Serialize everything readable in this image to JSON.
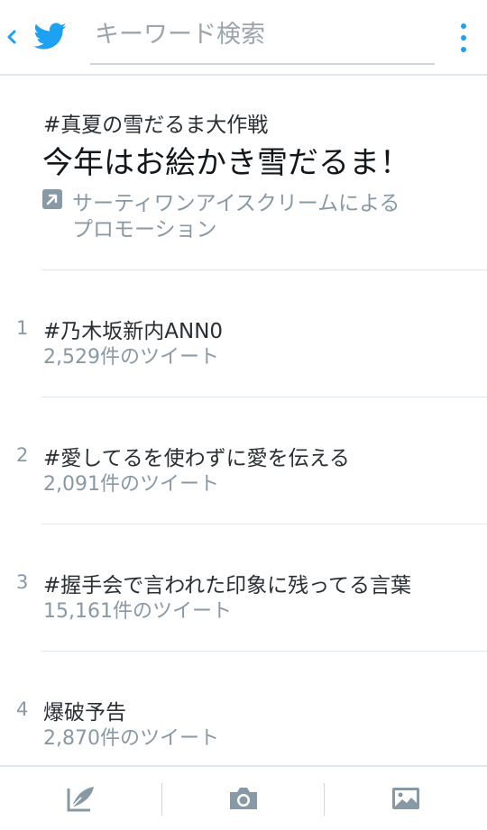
{
  "header": {
    "search_placeholder": "キーワード検索",
    "brand_color": "#1da1f2"
  },
  "promoted": {
    "hashtag": "#真夏の雪だるま大作戦",
    "headline": "今年はお絵かき雪だるま！",
    "promo_line1": "サーティワンアイスクリームによる",
    "promo_line2": "プロモーション"
  },
  "trends": [
    {
      "rank": "1",
      "name": "#乃木坂新内ANN0",
      "count": "2,529件のツイート"
    },
    {
      "rank": "2",
      "name": "#愛してるを使わずに愛を伝える",
      "count": "2,091件のツイート"
    },
    {
      "rank": "3",
      "name": "#握手会で言われた印象に残ってる言葉",
      "count": "15,161件のツイート"
    },
    {
      "rank": "4",
      "name": "爆破予告",
      "count": "2,870件のツイート"
    }
  ],
  "bottom_bar": {
    "icons": [
      "compose-icon",
      "camera-icon",
      "image-icon"
    ]
  }
}
